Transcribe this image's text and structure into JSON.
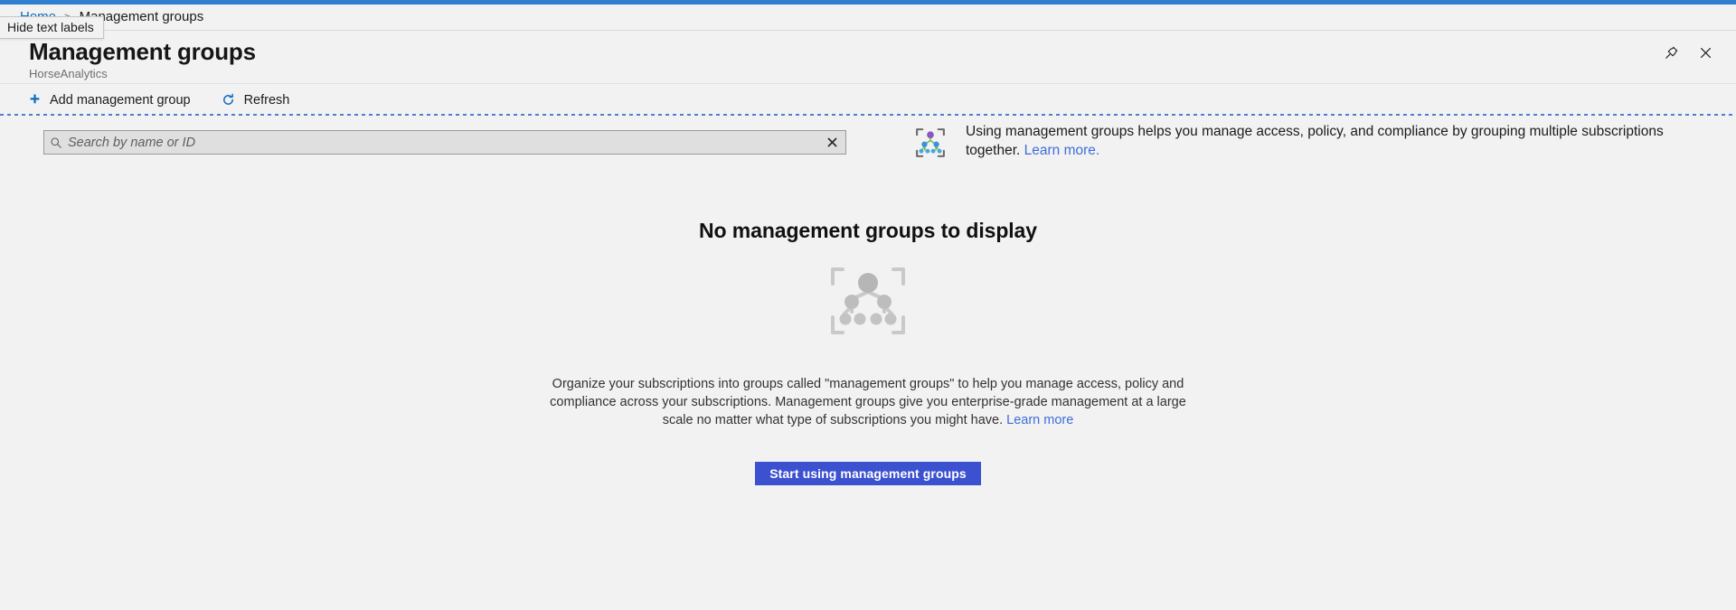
{
  "window": {
    "accent_color": "#2f7fd1"
  },
  "tooltip": {
    "text": "Hide text labels"
  },
  "breadcrumb": {
    "home": "Home",
    "separator": ">",
    "current": "Management groups"
  },
  "blade": {
    "title": "Management groups",
    "subtitle": "HorseAnalytics",
    "pin_label": "Pin blade",
    "close_label": "Close blade"
  },
  "toolbar": {
    "add_label": "Add management group",
    "refresh_label": "Refresh"
  },
  "search": {
    "placeholder": "Search by name or ID",
    "value": "",
    "clear_label": "✕"
  },
  "banner": {
    "text_before_link": "Using management groups helps you manage access, policy, and compliance by grouping multiple subscriptions together. ",
    "link_label": "Learn more.",
    "icon": "management-groups-icon"
  },
  "empty_state": {
    "title": "No management groups to display",
    "description_line1": "Organize your subscriptions into groups called \"management groups\" to help you manage access, policy and",
    "description_line2": "compliance across your subscriptions. Management groups give you enterprise-grade management at a large scale",
    "description_line3": "no matter what type of subscriptions you might have. ",
    "link_label": "Learn more",
    "button_label": "Start using management groups",
    "button_color": "#3b51cf",
    "illustration": "management-groups-hierarchy-illustration"
  }
}
